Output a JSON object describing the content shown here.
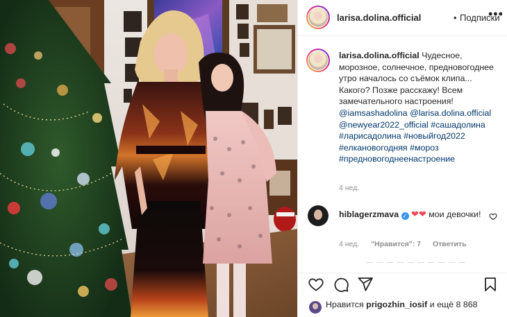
{
  "post": {
    "username": "larisa.dolina.official",
    "dot": "•",
    "follow_label": "Подписки",
    "more_icon": "more-dots-icon"
  },
  "caption": {
    "username": "larisa.dolina.official",
    "text": "Чудесное, морозное, солнечное, предновогоднее утро началось со съёмок клипа... Какого? Позже расскажу! Всем замечательного настроения!",
    "mention1": "@iamsashadolina",
    "mention2": "@larisa.dolina.official",
    "mention3": "@newyear2022_official",
    "hashtags": [
      "#сашадолина",
      "#ларисадолина",
      "#новыйгод2022",
      "#елкановогодняя",
      "#мороз",
      "#предновогоднеенастроение"
    ],
    "time": "4 нед."
  },
  "comment": {
    "username": "hiblagerzmava",
    "text": "мои девочки!",
    "time": "4 нед.",
    "likes_label": "\"Нравится\": 7",
    "reply_label": "Ответить",
    "hidden_more": "— — — — — — — — — —"
  },
  "likes": {
    "prefix": "Нравится",
    "user": "prigozhin_iosif",
    "suffix": "и ещё 8 868"
  },
  "colors": {
    "link": "#00376b",
    "heart": "#ed4956",
    "muted": "#8e8e8e",
    "verified": "#3897f0"
  }
}
